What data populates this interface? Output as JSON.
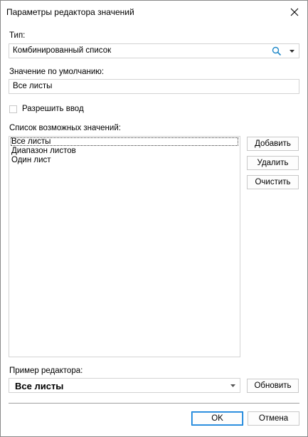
{
  "window": {
    "title": "Параметры редактора значений"
  },
  "type_section": {
    "label": "Тип:",
    "value": "Комбинированный список"
  },
  "default_section": {
    "label": "Значение по умолчанию:",
    "value": "Все листы"
  },
  "allow_input": {
    "label": "Разрешить ввод",
    "checked": false
  },
  "values_list": {
    "label": "Список возможных значений:",
    "items": [
      "Все листы",
      "Диапазон листов",
      "Один лист"
    ]
  },
  "side_buttons": {
    "add": "Добавить",
    "delete": "Удалить",
    "clear": "Очистить"
  },
  "preview": {
    "label": "Пример редактора:",
    "value": "Все листы",
    "refresh": "Обновить"
  },
  "footer": {
    "ok": "OK",
    "cancel": "Отмена"
  },
  "colors": {
    "accent": "#0078d7",
    "search_icon": "#1e88c8",
    "border": "#d3d3d3"
  },
  "icons": {
    "close": "close-icon",
    "search": "search-icon",
    "dropdown": "chevron-down-icon"
  }
}
